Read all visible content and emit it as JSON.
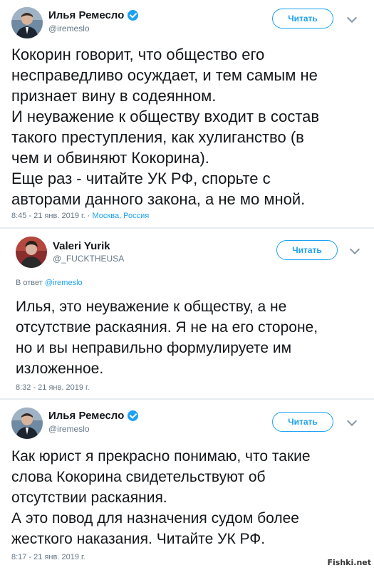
{
  "tweets": [
    {
      "author": "Илья Ремесло",
      "handle": "@iremeslo",
      "verified": true,
      "follow_label": "Читать",
      "text": "Кокорин говорит, что общество его\nнесправедливо осуждает, и тем самым не\nпризнает вину в содеянном.\nИ неуважение к обществу входит в состав\nтакого преступления, как хулиганство (в\nчем и обвиняют Кокорина).\nЕще раз - читайте УК РФ, спорьте с\nавторами данного закона, а не мо мной.",
      "time": "8:45 - 21 янв. 2019 г.",
      "location": "Москва, Россия"
    },
    {
      "author": "Valeri Yurik",
      "handle": "@_FUCKTHEUSA",
      "verified": false,
      "follow_label": "Читать",
      "reply_prefix": "В ответ",
      "reply_mention": "@iremeslo",
      "text": "Илья, это неуважение к обществу, а не\nотсутствие раскаяния. Я не на его стороне,\nно и вы неправильно формулируете им\nизложенное.",
      "time": "8:32 - 21 янв. 2019 г."
    },
    {
      "author": "Илья Ремесло",
      "handle": "@iremeslo",
      "verified": true,
      "follow_label": "Читать",
      "text": "Как юрист я прекрасно понимаю, что такие\nслова Кокорина свидетельствуют об\nотсутствии раскаяния.\nА это повод для назначения судом более\nжесткого наказания. Читайте УК РФ.",
      "time": "8:17 - 21 янв. 2019 г."
    }
  ],
  "watermark": "Fishki.net",
  "colors": {
    "accent": "#1da1f2",
    "muted": "#657786",
    "text": "#14171a"
  }
}
